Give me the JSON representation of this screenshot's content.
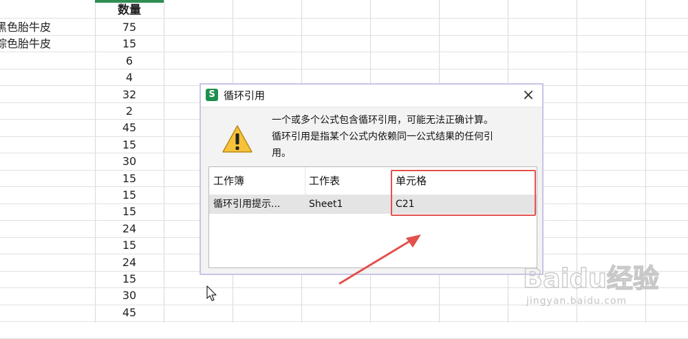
{
  "sheet": {
    "column_header": "数量",
    "labels": [
      "黑色胎牛皮",
      "棕色胎牛皮"
    ],
    "values": [
      "75",
      "15",
      "6",
      "4",
      "32",
      "2",
      "45",
      "15",
      "30",
      "15",
      "15",
      "15",
      "24",
      "15",
      "24",
      "15",
      "30",
      "45"
    ]
  },
  "dialog": {
    "title": "循环引用",
    "app_icon": "S",
    "close_icon": "×",
    "message_line1": "一个或多个公式包含循环引用，可能无法正确计算。",
    "message_line2": "循环引用是指某个公式内依赖同一公式结果的任何引",
    "message_line3": "用。",
    "table": {
      "headers": [
        "工作簿",
        "工作表",
        "单元格"
      ],
      "row": [
        "循环引用提示...",
        "Sheet1",
        "C21"
      ]
    }
  },
  "watermark": {
    "brand": "Baidu经验",
    "url": "jingyan.baidu.com"
  },
  "colors": {
    "accent_green": "#1f8f4e",
    "highlight_red": "#e3504c"
  }
}
